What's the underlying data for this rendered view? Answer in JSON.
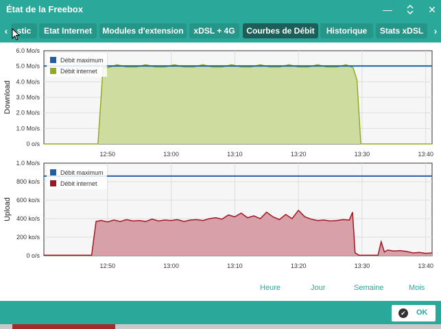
{
  "window": {
    "title": "État de la Freebox",
    "minimize_glyph": "—",
    "restore_glyph": "⌃⌄",
    "close_glyph": "✕"
  },
  "tabs": {
    "prev_glyph": "‹",
    "next_glyph": "›",
    "items": [
      {
        "label": "stic",
        "active": false
      },
      {
        "label": "Etat Internet",
        "active": false
      },
      {
        "label": "Modules d'extension",
        "active": false
      },
      {
        "label": "xDSL + 4G",
        "active": false
      },
      {
        "label": "Courbes de Débit",
        "active": true
      },
      {
        "label": "Historique",
        "active": false
      },
      {
        "label": "Stats xDSL",
        "active": false
      }
    ]
  },
  "periods": [
    "Heure",
    "Jour",
    "Semaine",
    "Mois"
  ],
  "footer": {
    "ok_label": "OK",
    "ok_glyph": "✔"
  },
  "colors": {
    "accent": "#2aa89a",
    "max_line": "#1f5fa8",
    "download_fill": "#cfdca0",
    "download_line": "#8fac1e",
    "upload_fill": "#d8a0a8",
    "upload_line": "#a01620"
  },
  "chart_data": [
    {
      "type": "area",
      "ylabel": "Download",
      "ylim": [
        0,
        6
      ],
      "y_ticks": [
        "0 o/s",
        "1.0 Mo/s",
        "2.0 Mo/s",
        "3.0 Mo/s",
        "4.0 Mo/s",
        "5.0 Mo/s",
        "6.0 Mo/s"
      ],
      "x_ticks": [
        "12:50",
        "13:00",
        "13:10",
        "13:20",
        "13:30",
        "13:40"
      ],
      "xlim_minutes_after_12_40": [
        0,
        61
      ],
      "legend_position": "top-left",
      "grid": true,
      "series": [
        {
          "name": "Débit maximum",
          "x_minutes": [
            0,
            61
          ],
          "values": [
            5.02,
            5.02
          ]
        },
        {
          "name": "Débit internet",
          "x_minutes": [
            0,
            8.5,
            9.3,
            10,
            11.5,
            13,
            14.5,
            16,
            17.5,
            19,
            20.5,
            22,
            23.5,
            25,
            26.5,
            28,
            29.5,
            31,
            32.5,
            34,
            35.5,
            37,
            38.5,
            40,
            41.5,
            43,
            44.5,
            46,
            47.5,
            48.6,
            49.2,
            49.8,
            61
          ],
          "values": [
            0,
            0,
            4.95,
            4.9,
            5.1,
            4.95,
            4.95,
            5.1,
            4.95,
            4.95,
            5.1,
            4.95,
            4.95,
            5.1,
            4.95,
            4.95,
            5.1,
            4.95,
            4.95,
            5.1,
            4.95,
            4.95,
            5.1,
            4.95,
            4.95,
            5.1,
            4.95,
            4.95,
            5.1,
            4.9,
            4.1,
            0,
            0
          ]
        }
      ]
    },
    {
      "type": "area",
      "ylabel": "Upload",
      "ylim": [
        0,
        1000
      ],
      "y_ticks": [
        "0 o/s",
        "200 ko/s",
        "400 ko/s",
        "600 ko/s",
        "800 ko/s",
        "1.0 Mo/s"
      ],
      "x_ticks": [
        "12:50",
        "13:00",
        "13:10",
        "13:20",
        "13:30",
        "13:40"
      ],
      "xlim_minutes_after_12_40": [
        0,
        61
      ],
      "legend_position": "top-left",
      "grid": true,
      "series": [
        {
          "name": "Débit maximum",
          "x_minutes": [
            0,
            61
          ],
          "values": [
            860,
            860
          ]
        },
        {
          "name": "Débit internet",
          "x_minutes": [
            0,
            7.5,
            8.2,
            9,
            10,
            11,
            12,
            13,
            14,
            15,
            16,
            17,
            18,
            19,
            20,
            21,
            22,
            23,
            24,
            25,
            26,
            27,
            28,
            29,
            30,
            31,
            32,
            33,
            34,
            35,
            36,
            37,
            38,
            39,
            40,
            41,
            42,
            43,
            44,
            45,
            46,
            47,
            48,
            48.5,
            48.9,
            49.5,
            52.5,
            53,
            53.5,
            54,
            55,
            56,
            57,
            58,
            59,
            60,
            61
          ],
          "values": [
            5,
            5,
            370,
            380,
            365,
            385,
            370,
            390,
            375,
            380,
            370,
            395,
            375,
            385,
            380,
            390,
            370,
            385,
            390,
            380,
            400,
            410,
            395,
            440,
            420,
            460,
            410,
            430,
            400,
            470,
            420,
            390,
            445,
            400,
            490,
            420,
            395,
            380,
            385,
            375,
            380,
            390,
            385,
            470,
            30,
            5,
            5,
            150,
            40,
            60,
            50,
            55,
            45,
            30,
            35,
            25,
            30
          ]
        }
      ]
    }
  ]
}
